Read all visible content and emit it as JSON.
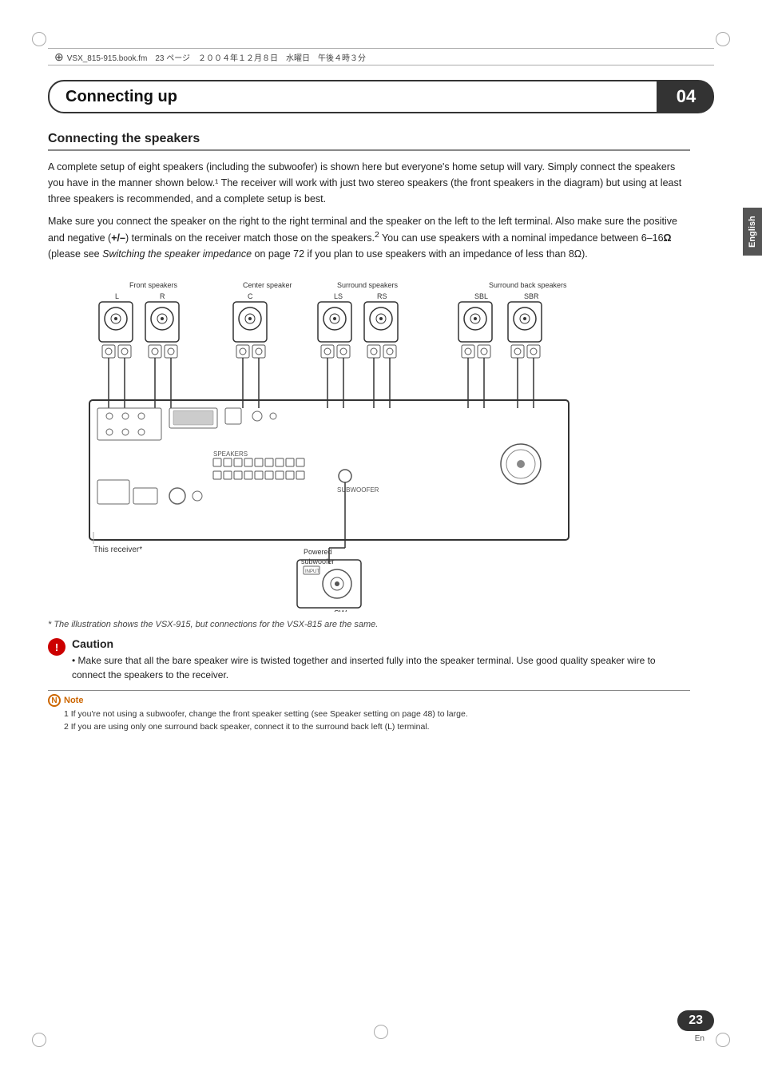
{
  "top_strip": {
    "text": "VSX_815-915.book.fm　23 ページ　２００４年１２月８日　水曜日　午後４時３分"
  },
  "chapter": {
    "title": "Connecting up",
    "number": "04"
  },
  "sidebar": {
    "label": "English"
  },
  "section": {
    "heading": "Connecting the speakers",
    "paragraphs": [
      "A complete setup of eight speakers (including the subwoofer) is shown here but everyone's home setup will vary. Simply connect the speakers you have in the manner shown below.¹ The receiver will work with just two stereo speakers (the front speakers in the diagram) but using at least three speakers is recommended, and a complete setup is best.",
      "Make sure you connect the speaker on the right to the right terminal and the speaker on the left to the left terminal. Also make sure the positive and negative (+/–) terminals on the receiver match those on the speakers.² You can use speakers with a nominal impedance between 6–16Ω (please see Switching the speaker impedance on page 72 if you plan to use speakers with an impedance of less than 8Ω)."
    ]
  },
  "diagram": {
    "caption": "* The illustration shows the VSX-915, but connections for the VSX-815 are the same.",
    "labels": {
      "front_speakers": "Front speakers",
      "center_speaker": "Center speaker",
      "surround_speakers": "Surround speakers",
      "surround_back_speakers": "Surround back speakers",
      "front_l": "L",
      "front_r": "R",
      "center": "C",
      "surround_ls": "LS",
      "surround_rs": "RS",
      "surround_back_sbl": "SBL",
      "surround_back_sbr": "SBR",
      "this_receiver": "This receiver*",
      "powered_subwoofer": "Powered subwoofer",
      "sw": "SW"
    }
  },
  "caution": {
    "icon": "!",
    "title": "Caution",
    "text": "Make sure that all the bare speaker wire is twisted together and inserted fully into the speaker terminal. Use good quality speaker wire to connect the speakers to the receiver."
  },
  "note": {
    "icon": "N",
    "label": "Note",
    "lines": [
      "1  If you're not using a subwoofer, change the front speaker setting (see Speaker setting on page 48) to large.",
      "2  If you are using only one surround back speaker, connect it to the surround back left (L) terminal."
    ]
  },
  "page": {
    "number": "23",
    "en": "En"
  }
}
